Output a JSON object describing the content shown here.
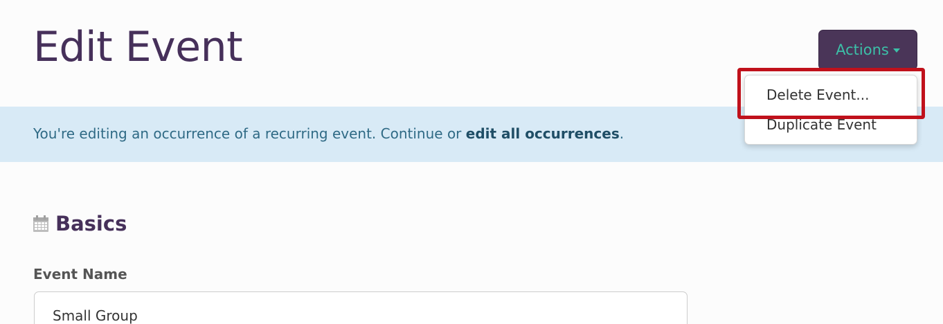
{
  "header": {
    "title": "Edit Event",
    "actions_label": "Actions"
  },
  "actions_menu": {
    "items": [
      {
        "label": "Delete Event..."
      },
      {
        "label": "Duplicate Event"
      }
    ],
    "highlight_color": "#c0111b"
  },
  "notice": {
    "text": "You're editing an occurrence of a recurring event. Continue or ",
    "link_label": "edit all occurrences",
    "suffix": "."
  },
  "basics": {
    "title": "Basics",
    "icon": "calendar-icon",
    "event_name_label": "Event Name",
    "event_name_value": "Small Group"
  },
  "colors": {
    "brand_purple": "#46305a",
    "button_bg": "#4a3558",
    "button_text": "#3cc0a8",
    "notice_bg": "#d8eaf6"
  }
}
